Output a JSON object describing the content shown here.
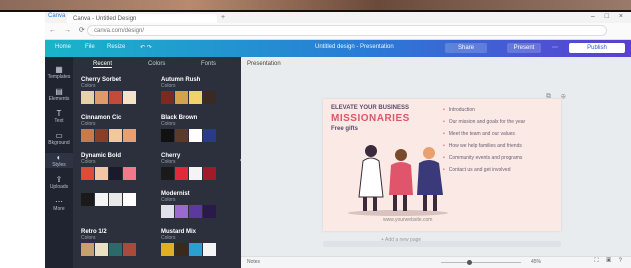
{
  "browser": {
    "app_label": "Canva",
    "tab_title": "Canva - Untitled Design",
    "new_tab": "+",
    "window_controls": "– □ ×",
    "nav_icons": "← → ⟳",
    "url": "canva.com/design/"
  },
  "canva_bar": {
    "home": "Home",
    "file": "File",
    "resize": "Resize",
    "undo_redo": "↶ ↷",
    "title": "Untitled design - Presentation",
    "share": "Share",
    "present": "Present",
    "more": "⋯",
    "publish": "Publish"
  },
  "rail": [
    {
      "icon": "▦",
      "label": "Templates"
    },
    {
      "icon": "▤",
      "label": "Elements"
    },
    {
      "icon": "T",
      "label": "Text"
    },
    {
      "icon": "▭",
      "label": "Bkground"
    },
    {
      "icon": "◐",
      "label": "Styles"
    },
    {
      "icon": "⇪",
      "label": "Uploads"
    },
    {
      "icon": "⋯",
      "label": "More"
    }
  ],
  "panel": {
    "tabs": [
      "Recent",
      "Colors",
      "Fonts"
    ],
    "palettes": [
      {
        "name": "Cherry Sorbet",
        "sub": "Colors",
        "colors": [
          "#e6d2a6",
          "#e09a6a",
          "#c44a3a",
          "#f4e3c6"
        ]
      },
      {
        "name": "Autumn Rush",
        "sub": "Colors",
        "colors": [
          "#7a2a1e",
          "#d4a24a",
          "#f2d36a",
          "#3a2a22"
        ]
      },
      {
        "name": "Cinnamon Cic",
        "sub": "Colors",
        "colors": [
          "#c77a4a",
          "#8a3e2a",
          "#f0c89a",
          "#e8a070"
        ]
      },
      {
        "name": "Black Brown",
        "sub": "Colors",
        "colors": [
          "#111111",
          "#5a3a2a",
          "#ffffff",
          "#2a3a8a"
        ]
      },
      {
        "name": "Dynamic Bold",
        "sub": "Colors",
        "colors": [
          "#e04a3a",
          "#f4c6a4",
          "#1a1a2a",
          "#f07a8a"
        ]
      },
      {
        "name": "Cherry",
        "sub": "Colors",
        "colors": [
          "#1a1a1a",
          "#e02a3a",
          "#f4f4f4",
          "#a01a2a"
        ]
      },
      {
        "name": "",
        "sub": "",
        "colors": [
          "#1a1a1a",
          "#f4f4f4",
          "#e8e8e8",
          "#ffffff"
        ]
      },
      {
        "name": "Modernist",
        "sub": "Colors",
        "colors": [
          "#e0e0ea",
          "#9a6ad0",
          "#5a3aa0",
          "#2a1a4a"
        ]
      },
      {
        "name": "Retro 1/2",
        "sub": "Colors",
        "colors": [
          "#c8a070",
          "#eae0c6",
          "#2a6a6a",
          "#aa4a3a"
        ]
      },
      {
        "name": "Mustard Mix",
        "sub": "Colors",
        "colors": [
          "#e0b020",
          "#3a2a1a",
          "#2aa0d0",
          "#f4f4f4"
        ]
      }
    ]
  },
  "workspace": {
    "title": "Presentation",
    "slide": {
      "pre": "ELEVATE YOUR BUSINESS",
      "title": "MISSIONARIES",
      "sub": "Free gifts",
      "list": [
        "Introduction",
        "Our mission and goals for the year",
        "Meet the team and our values",
        "How we help families and friends",
        "Community events and programs",
        "Contact us and get involved"
      ],
      "footer": "www.yourwebsite.com"
    },
    "slide_icons": "⧉ ⊕",
    "note": "+ Add a new page",
    "bottom": {
      "notes": "Notes",
      "zoom": "45%",
      "icons": "⛶ ▣ ?"
    }
  },
  "colors": {
    "accent_start": "#19b5c9",
    "accent_end": "#5c3fd0",
    "slide_bg": "#fbe9e6",
    "slide_title": "#e0556b"
  }
}
